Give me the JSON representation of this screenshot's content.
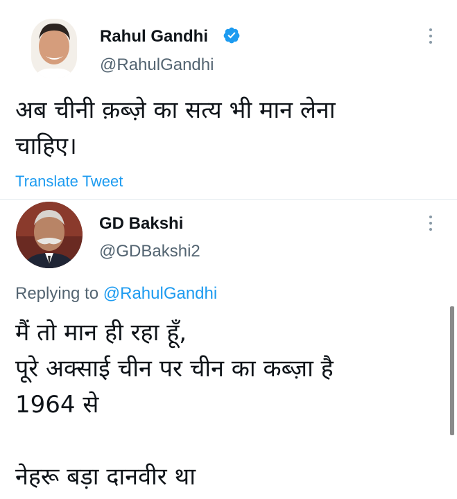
{
  "tweets": [
    {
      "name": "Rahul Gandhi",
      "handle": "@RahulGandhi",
      "verified": true,
      "text": "अब चीनी क़ब्ज़े का सत्य भी मान लेना\nचाहिए।",
      "translate_label": "Translate Tweet"
    },
    {
      "name": "GD Bakshi",
      "handle": "@GDBakshi2",
      "verified": false,
      "replying_prefix": "Replying to",
      "replying_to": "@RahulGandhi",
      "text": "मैं तो मान ही रहा हूँ,\nपूरे अक्साई चीन पर चीन का कब्ज़ा है\n1964 से\n\nनेहरू बड़ा दानवीर था"
    }
  ],
  "icons": {
    "verified": "verified-badge-icon",
    "more": "more-options-icon"
  },
  "colors": {
    "link": "#1d9bf0",
    "secondary_text": "#536471",
    "verified_badge": "#1d9bf0"
  }
}
